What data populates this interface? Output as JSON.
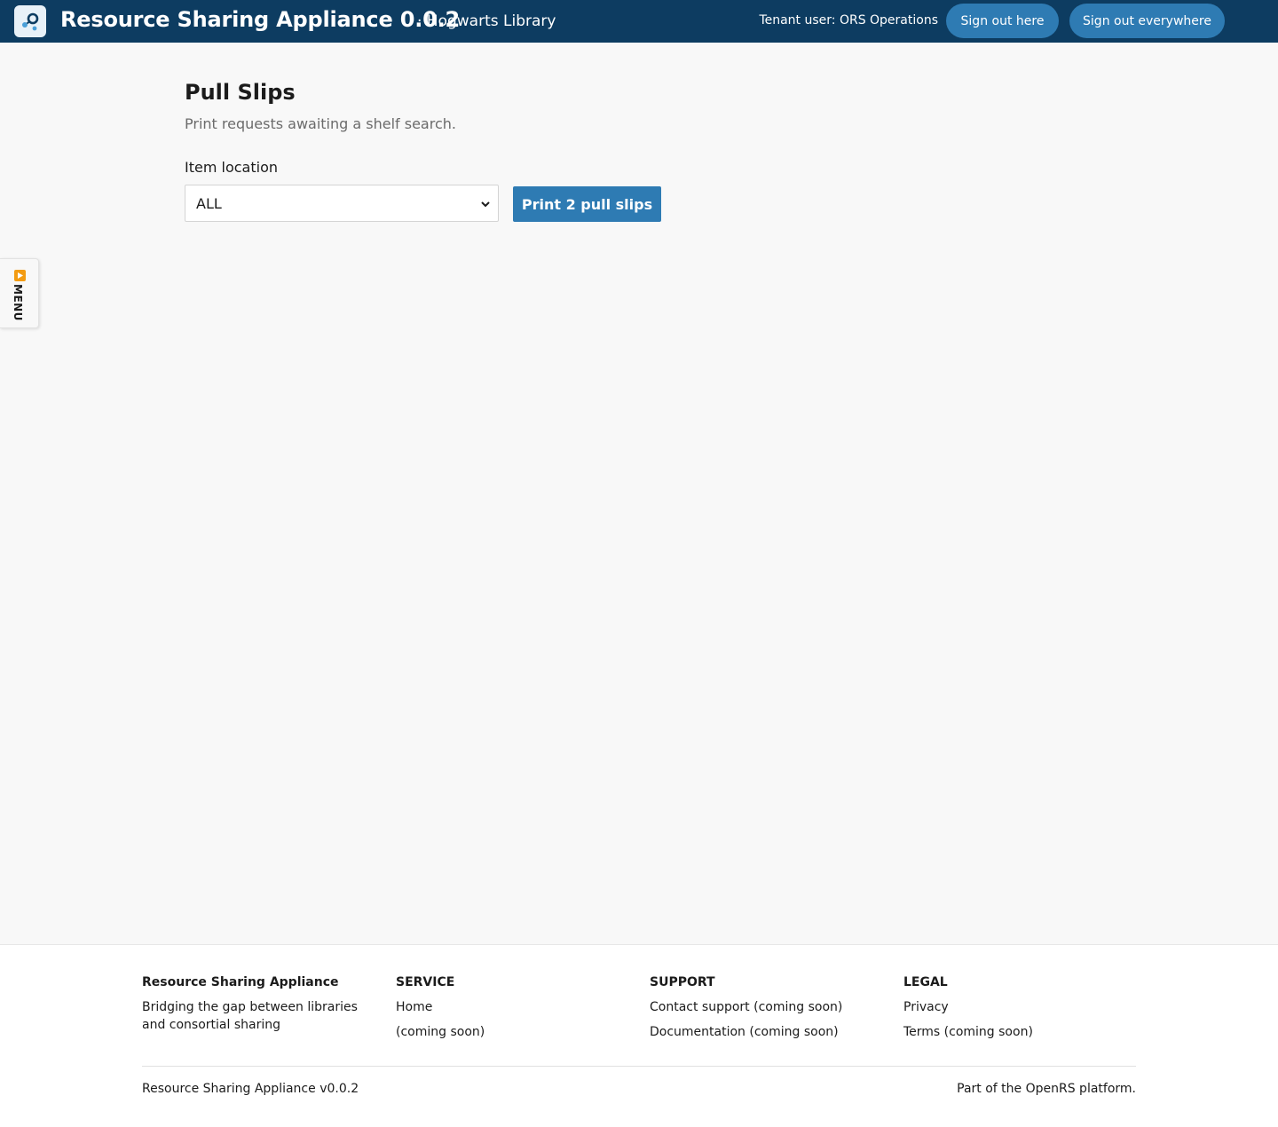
{
  "header": {
    "app_title": "Resource Sharing Appliance 0.0.2",
    "tenant_name": "· Hogwarts Library",
    "tenant_user": "Tenant user: ORS Operations",
    "sign_out_here": "Sign out here",
    "sign_out_everywhere": "Sign out everywhere",
    "logo_icon": "share-nodes-icon"
  },
  "side_menu": {
    "label": "MENU",
    "icon": "play-icon"
  },
  "main": {
    "title": "Pull Slips",
    "subtitle": "Print requests awaiting a shelf search.",
    "location_label": "Item location",
    "location_selected": "ALL",
    "print_button": "Print 2 pull slips"
  },
  "footer": {
    "brand_title": "Resource Sharing Appliance",
    "brand_text": "Bridging the gap between libraries and consortial sharing",
    "service_heading": "SERVICE",
    "service_links": [
      "Home",
      "(coming soon)"
    ],
    "support_heading": "SUPPORT",
    "support_links": [
      "Contact support (coming soon)",
      "Documentation (coming soon)"
    ],
    "legal_heading": "LEGAL",
    "legal_links": [
      "Privacy",
      "Terms (coming soon)"
    ],
    "version": "Resource Sharing Appliance v0.0.2",
    "platform": "Part of the OpenRS platform."
  },
  "colors": {
    "header_bg": "#0d3c61",
    "primary_button": "#2e7bb3",
    "menu_icon": "#f39c12"
  }
}
